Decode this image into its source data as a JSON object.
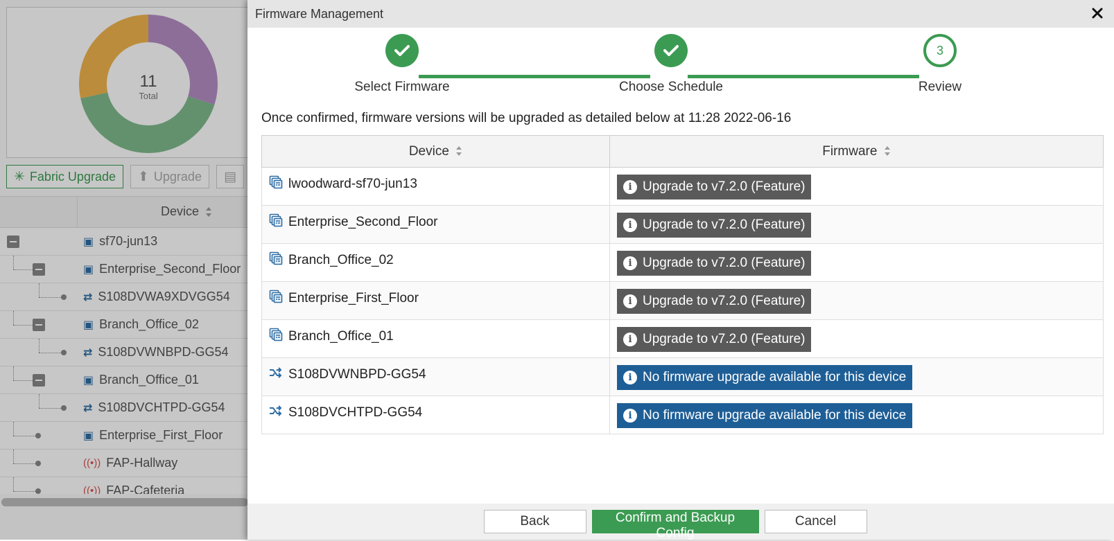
{
  "background": {
    "donut": {
      "total_value": "11",
      "total_label": "Total"
    },
    "toolbar": {
      "fabric_upgrade": "Fabric Upgrade",
      "upgrade": "Upgrade"
    },
    "grid": {
      "header_device": "Device",
      "rows": [
        {
          "name": "sf70-jun13",
          "icon": "fortigate-icon"
        },
        {
          "name": "Enterprise_Second_Floor",
          "icon": "fortigate-icon"
        },
        {
          "name": "S108DVWA9XDVGG54",
          "icon": "switch-icon"
        },
        {
          "name": "Branch_Office_02",
          "icon": "fortigate-icon"
        },
        {
          "name": "S108DVWNBPD-GG54",
          "icon": "switch-icon"
        },
        {
          "name": "Branch_Office_01",
          "icon": "fortigate-icon"
        },
        {
          "name": "S108DVCHTPD-GG54",
          "icon": "switch-icon"
        },
        {
          "name": "Enterprise_First_Floor",
          "icon": "fortigate-icon"
        },
        {
          "name": "FAP-Hallway",
          "icon": "access-point-icon"
        },
        {
          "name": "FAP-Cafeteria",
          "icon": "access-point-icon"
        }
      ]
    }
  },
  "dialog": {
    "title": "Firmware Management",
    "steps": [
      {
        "label": "Select Firmware",
        "state": "done"
      },
      {
        "label": "Choose Schedule",
        "state": "done"
      },
      {
        "label": "Review",
        "state": "current",
        "number": "3"
      }
    ],
    "message": "Once confirmed, firmware versions will be upgraded as detailed below at 11:28 2022-06-16",
    "table": {
      "headers": {
        "device": "Device",
        "firmware": "Firmware"
      },
      "rows": [
        {
          "device": "lwoodward-sf70-jun13",
          "icon": "fortigate-icon",
          "firmware": "Upgrade to v7.2.0 (Feature)",
          "status": "feature"
        },
        {
          "device": "Enterprise_Second_Floor",
          "icon": "fortigate-icon",
          "firmware": "Upgrade to v7.2.0 (Feature)",
          "status": "feature"
        },
        {
          "device": "Branch_Office_02",
          "icon": "fortigate-icon",
          "firmware": "Upgrade to v7.2.0 (Feature)",
          "status": "feature"
        },
        {
          "device": "Enterprise_First_Floor",
          "icon": "fortigate-icon",
          "firmware": "Upgrade to v7.2.0 (Feature)",
          "status": "feature"
        },
        {
          "device": "Branch_Office_01",
          "icon": "fortigate-icon",
          "firmware": "Upgrade to v7.2.0 (Feature)",
          "status": "feature"
        },
        {
          "device": "S108DVWNBPD-GG54",
          "icon": "switch-icon",
          "firmware": "No firmware upgrade available for this device",
          "status": "none"
        },
        {
          "device": "S108DVCHTPD-GG54",
          "icon": "switch-icon",
          "firmware": "No firmware upgrade available for this device",
          "status": "none"
        }
      ]
    },
    "footer": {
      "back": "Back",
      "confirm": "Confirm and Backup Config",
      "cancel": "Cancel"
    }
  },
  "colors": {
    "accent_green": "#3b9b52",
    "badge_feature": "#5a5a5a",
    "badge_none": "#1e5e96",
    "device_icon": "#2e6da4"
  }
}
